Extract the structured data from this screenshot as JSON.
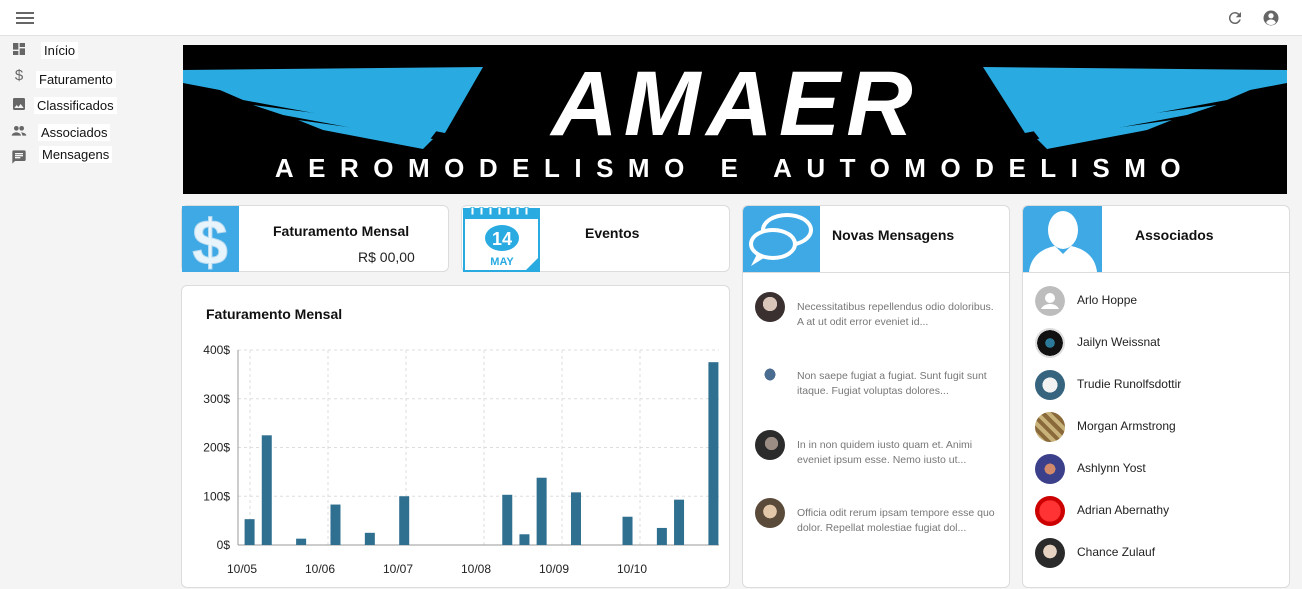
{
  "sidebar": {
    "items": [
      {
        "label": "Início",
        "icon": "dashboard-icon"
      },
      {
        "label": "Faturamento",
        "icon": "dollar-icon"
      },
      {
        "label": "Classificados",
        "icon": "image-icon"
      },
      {
        "label": "Associados",
        "icon": "people-icon"
      },
      {
        "label": "Mensagens",
        "icon": "message-icon"
      }
    ]
  },
  "banner": {
    "logo_text": "AMAER",
    "tagline": "AEROMODELISMO E AUTOMODELISMO",
    "accent": "#29abe2"
  },
  "stats": {
    "faturamento": {
      "title": "Faturamento Mensal",
      "value": "R$ 00,00"
    },
    "eventos": {
      "title": "Eventos",
      "calendar_day": "14",
      "calendar_month": "MAY"
    }
  },
  "chart_data": {
    "type": "bar",
    "title": "Faturamento Mensal",
    "xlabel": "",
    "ylabel": "",
    "ylim": [
      0,
      400
    ],
    "y_ticks": [
      "0$",
      "100$",
      "200$",
      "300$",
      "400$"
    ],
    "x_ticks": [
      "10/05",
      "10/06",
      "10/07",
      "10/08",
      "10/09",
      "10/10"
    ],
    "values": [
      53,
      225,
      0,
      13,
      0,
      83,
      0,
      25,
      0,
      100,
      0,
      0,
      0,
      0,
      0,
      103,
      22,
      138,
      0,
      108,
      0,
      0,
      58,
      0,
      35,
      93,
      0,
      375
    ],
    "bar_color": "#2f6f8f",
    "grid": true
  },
  "messages": {
    "title": "Novas Mensagens",
    "items": [
      {
        "text": "Necessitatibus repellendus odio doloribus. A at ut odit error eveniet id..."
      },
      {
        "text": "Non saepe fugiat a fugiat. Sunt fugit sunt itaque. Fugiat voluptas dolores..."
      },
      {
        "text": "In in non quidem iusto quam et. Animi eveniet ipsum esse. Nemo iusto ut..."
      },
      {
        "text": "Officia odit rerum ipsam tempore esse quo dolor. Repellat molestiae fugiat dol..."
      }
    ]
  },
  "associados": {
    "title": "Associados",
    "items": [
      {
        "name": "Arlo Hoppe"
      },
      {
        "name": "Jailyn Weissnat"
      },
      {
        "name": "Trudie Runolfsdottir"
      },
      {
        "name": "Morgan Armstrong"
      },
      {
        "name": "Ashlynn Yost"
      },
      {
        "name": "Adrian Abernathy"
      },
      {
        "name": "Chance Zulauf"
      }
    ]
  }
}
